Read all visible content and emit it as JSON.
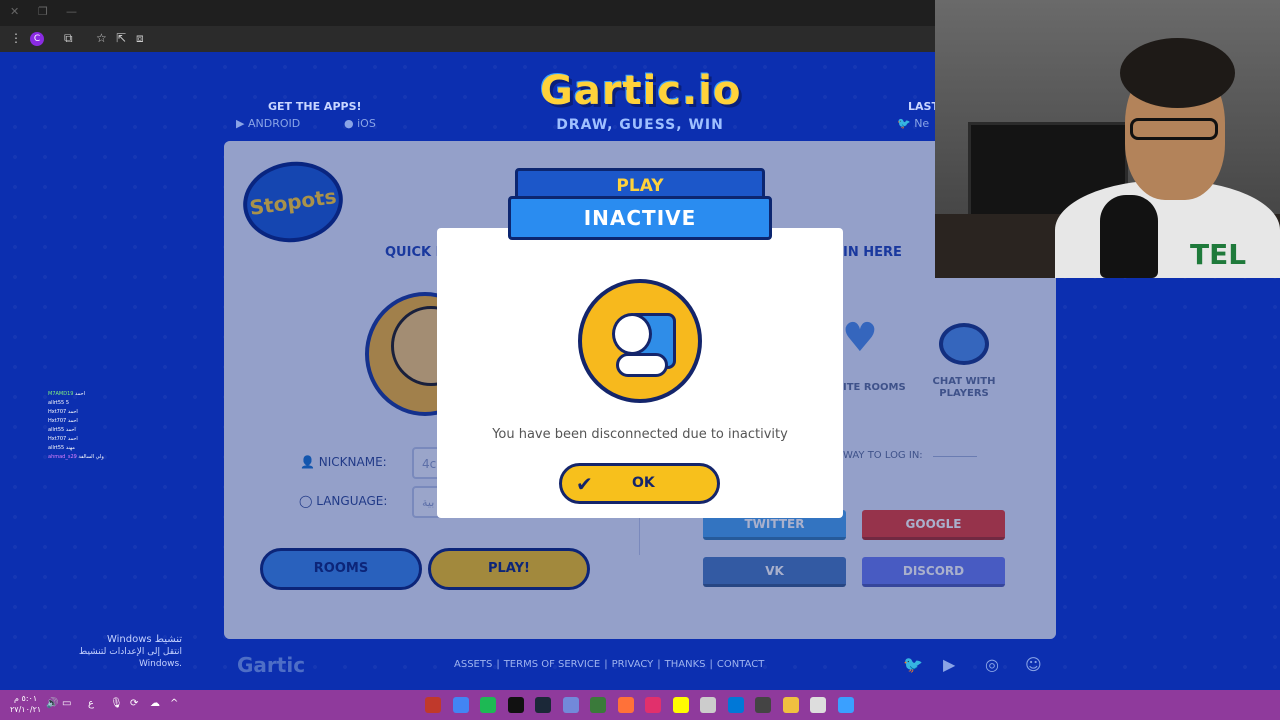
{
  "browser": {
    "ext_letter": "C"
  },
  "site": {
    "logo_text": "Gartic.io",
    "tagline": "DRAW, GUESS, WIN",
    "apps_title": "GET THE APPS!",
    "android_label": "ANDROID",
    "ios_label": "iOS",
    "last_title": "LAST",
    "last_twitter": "Ne",
    "stopots_text": "Stopots",
    "quick_play_label": "QUICK P",
    "login_label": "IN HERE",
    "favorite_rooms_label": "ITE ROOMS",
    "chat_with_players_label": "CHAT WITH PLAYERS",
    "nickname_label": "NICKNAME:",
    "nickname_value": "4c",
    "language_label": "LANGUAGE:",
    "language_value": "بية",
    "other_way_label": "WAY TO LOG IN:",
    "rooms_button": "ROOMS",
    "play_button": "PLAY!",
    "twitter_button": "TWITTER",
    "google_button": "GOOGLE",
    "vk_button": "VK",
    "discord_button": "DISCORD"
  },
  "modal": {
    "banner_top": "PLAY",
    "banner_main": "INACTIVE",
    "message": "You have been disconnected due to inactivity",
    "ok_label": "OK"
  },
  "footer": {
    "logo": "Gartic",
    "links": [
      "ASSETS",
      "|",
      "TERMS OF SERVICE",
      "|",
      "PRIVACY",
      "|",
      "THANKS",
      "|",
      "CONTACT"
    ]
  },
  "side_chat": [
    {
      "name": "M7AMD19",
      "text": "احمد",
      "cls": "g"
    },
    {
      "name": "allrt55",
      "text": "5",
      "cls": ""
    },
    {
      "name": "Hxt707",
      "text": "احمد",
      "cls": ""
    },
    {
      "name": "Hxt707",
      "text": "احمد",
      "cls": ""
    },
    {
      "name": "allrt55",
      "text": "احمد",
      "cls": ""
    },
    {
      "name": "Hxt707",
      "text": "احمد",
      "cls": ""
    },
    {
      "name": "allrt55",
      "text": "مهند",
      "cls": ""
    },
    {
      "name": "ahmad_s29",
      "text": "ولي السالفة",
      "cls": "p"
    }
  ],
  "windows_watermark": {
    "line1": "Windows تنشيط",
    "line2": "انتقل إلى الإعدادات لتنشيط Windows."
  },
  "webcam": {
    "shirt_logo": "TEL"
  },
  "taskbar": {
    "clock_time": "٥:٠١ م",
    "clock_date": "٢٧/١٠/٢١",
    "lang": "ع",
    "icon_colors": [
      "#c0392b",
      "#4285f4",
      "#1db954",
      "#111111",
      "#1b2838",
      "#7289da",
      "#3a7a3a",
      "#ff7139",
      "#e1306c",
      "#fffc00",
      "#cccccc",
      "#0078d7",
      "#444444",
      "#f0c040",
      "#dddddd",
      "#3aa0ff"
    ]
  }
}
